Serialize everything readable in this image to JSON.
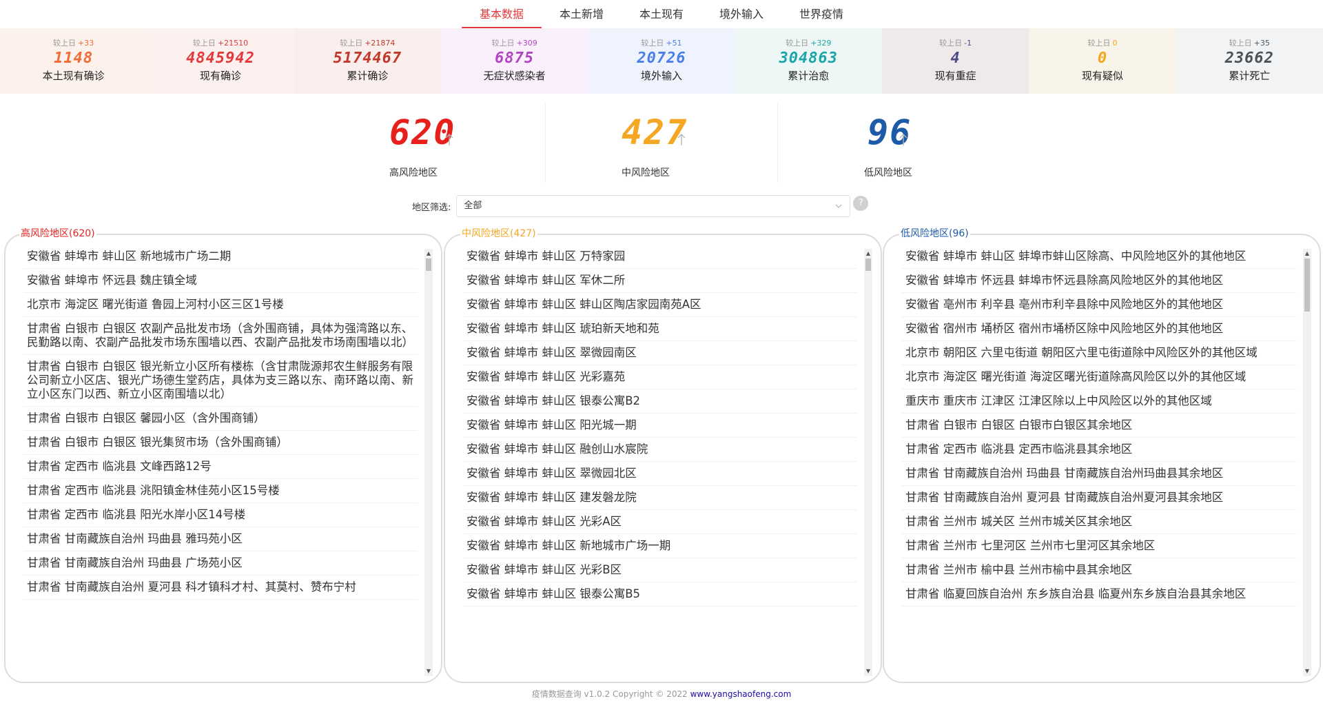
{
  "tabs": [
    {
      "label": "基本数据",
      "active": true
    },
    {
      "label": "本土新增",
      "active": false
    },
    {
      "label": "本土现有",
      "active": false
    },
    {
      "label": "境外输入",
      "active": false
    },
    {
      "label": "世界疫情",
      "active": false
    }
  ],
  "delta_prefix": "较上日",
  "stats": [
    {
      "delta": "+33",
      "value": "1148",
      "label": "本土现有确诊",
      "color": "#f26c36",
      "delta_color": "#f26c36",
      "bg": "#fdf1ec"
    },
    {
      "delta": "+21510",
      "value": "4845942",
      "label": "现有确诊",
      "color": "#e4393c",
      "delta_color": "#e4393c",
      "bg": "#fdf1ef"
    },
    {
      "delta": "+21874",
      "value": "5174467",
      "label": "累计确诊",
      "color": "#c0392b",
      "delta_color": "#c0392b",
      "bg": "#fbefed"
    },
    {
      "delta": "+309",
      "value": "6875",
      "label": "无症状感染者",
      "color": "#b146c2",
      "delta_color": "#b146c2",
      "bg": "#faf0fb"
    },
    {
      "delta": "+51",
      "value": "20726",
      "label": "境外输入",
      "color": "#4a7ee8",
      "delta_color": "#4a7ee8",
      "bg": "#eef3fd"
    },
    {
      "delta": "+329",
      "value": "304863",
      "label": "累计治愈",
      "color": "#1aa6a8",
      "delta_color": "#1aa6a8",
      "bg": "#eef7f6"
    },
    {
      "delta": "-1",
      "value": "4",
      "label": "现有重症",
      "color": "#4e4c87",
      "delta_color": "#4e4c87",
      "bg": "#efe9e9"
    },
    {
      "delta": "0",
      "value": "0",
      "label": "现有疑似",
      "color": "#f3a61a",
      "delta_color": "#f3a61a",
      "bg": "#f8f4ea"
    },
    {
      "delta": "+35",
      "value": "23662",
      "label": "累计死亡",
      "color": "#4d5257",
      "delta_color": "#4d5257",
      "bg": "#f1f3f4"
    }
  ],
  "risk": [
    {
      "value": "620",
      "label": "高风险地区",
      "color": "#e8201c"
    },
    {
      "value": "427",
      "label": "中风险地区",
      "color": "#f5a623"
    },
    {
      "value": "96",
      "label": "低风险地区",
      "color": "#1d5aa8"
    }
  ],
  "filter": {
    "label": "地区筛选:",
    "value": "全部"
  },
  "panels": [
    {
      "title": "高风险地区(620)",
      "color": "#e8201c",
      "scroll": {
        "thumb_fraction": 0.025,
        "thumb_offset": 0.0
      },
      "items": [
        "安徽省 蚌埠市 蚌山区 新地城市广场二期",
        "安徽省 蚌埠市 怀远县 魏庄镇全域",
        "北京市 海淀区 曙光街道 鲁园上河村小区三区1号楼",
        "甘肃省 白银市 白银区 农副产品批发市场（含外围商铺，具体为强湾路以东、民勤路以南、农副产品批发市场东围墙以西、农副产品批发市场南围墙以北）",
        "甘肃省 白银市 白银区 银光新立小区所有楼栋（含甘肃陇源邦农生鲜服务有限公司新立小区店、银光广场德生堂药店，具体为支三路以东、南环路以南、新立小区东门以西、新立小区南围墙以北）",
        "甘肃省 白银市 白银区 馨园小区（含外围商铺）",
        "甘肃省 白银市 白银区 银光集贸市场（含外围商铺）",
        "甘肃省 定西市 临洮县 文峰西路12号",
        "甘肃省 定西市 临洮县 洮阳镇金林佳苑小区15号楼",
        "甘肃省 定西市 临洮县 阳光水岸小区14号楼",
        "甘肃省 甘南藏族自治州 玛曲县 雅玛苑小区",
        "甘肃省 甘南藏族自治州 玛曲县 广场苑小区",
        "甘肃省 甘南藏族自治州 夏河县 科才镇科才村、其莫村、赞布宁村"
      ]
    },
    {
      "title": "中风险地区(427)",
      "color": "#f5a623",
      "scroll": {
        "thumb_fraction": 0.025,
        "thumb_offset": 0.0
      },
      "items": [
        "安徽省 蚌埠市 蚌山区 万特家园",
        "安徽省 蚌埠市 蚌山区 军休二所",
        "安徽省 蚌埠市 蚌山区 蚌山区陶店家园南苑A区",
        "安徽省 蚌埠市 蚌山区 琥珀新天地和苑",
        "安徽省 蚌埠市 蚌山区 翠微园南区",
        "安徽省 蚌埠市 蚌山区 光彩嘉苑",
        "安徽省 蚌埠市 蚌山区 银泰公寓B2",
        "安徽省 蚌埠市 蚌山区 阳光城一期",
        "安徽省 蚌埠市 蚌山区 融创山水宸院",
        "安徽省 蚌埠市 蚌山区 翠微园北区",
        "安徽省 蚌埠市 蚌山区 建发磐龙院",
        "安徽省 蚌埠市 蚌山区 光彩A区",
        "安徽省 蚌埠市 蚌山区 新地城市广场一期",
        "安徽省 蚌埠市 蚌山区 光彩B区",
        "安徽省 蚌埠市 蚌山区 银泰公寓B5"
      ]
    },
    {
      "title": "低风险地区(96)",
      "color": "#1d5aa8",
      "scroll": {
        "thumb_fraction": 0.13,
        "thumb_offset": 0.0
      },
      "items": [
        "安徽省 蚌埠市 蚌山区 蚌埠市蚌山区除高、中风险地区外的其他地区",
        "安徽省 蚌埠市 怀远县 蚌埠市怀远县除高风险地区外的其他地区",
        "安徽省 亳州市 利辛县 亳州市利辛县除中风险地区外的其他地区",
        "安徽省 宿州市 埇桥区 宿州市埇桥区除中风险地区外的其他地区",
        "北京市 朝阳区 六里屯街道 朝阳区六里屯街道除中风险区外的其他区域",
        "北京市 海淀区 曙光街道 海淀区曙光街道除高风险区以外的其他区域",
        "重庆市 重庆市 江津区 江津区除以上中风险区以外的其他区域",
        "甘肃省 白银市 白银区 白银市白银区其余地区",
        "甘肃省 定西市 临洮县 定西市临洮县其余地区",
        "甘肃省 甘南藏族自治州 玛曲县 甘南藏族自治州玛曲县其余地区",
        "甘肃省 甘南藏族自治州 夏河县 甘南藏族自治州夏河县其余地区",
        "甘肃省 兰州市 城关区 兰州市城关区其余地区",
        "甘肃省 兰州市 七里河区 兰州市七里河区其余地区",
        "甘肃省 兰州市 榆中县 兰州市榆中县其余地区",
        "甘肃省 临夏回族自治州 东乡族自治县 临夏州东乡族自治县其余地区"
      ]
    }
  ],
  "footer": {
    "text": "疫情数据查询 v1.0.2 Copyright © 2022 ",
    "link": "www.yangshaofeng.com"
  },
  "icons": {
    "up_arrow": "arrow-up-icon",
    "chevron": "chevron-down-icon",
    "help": "question-icon"
  }
}
